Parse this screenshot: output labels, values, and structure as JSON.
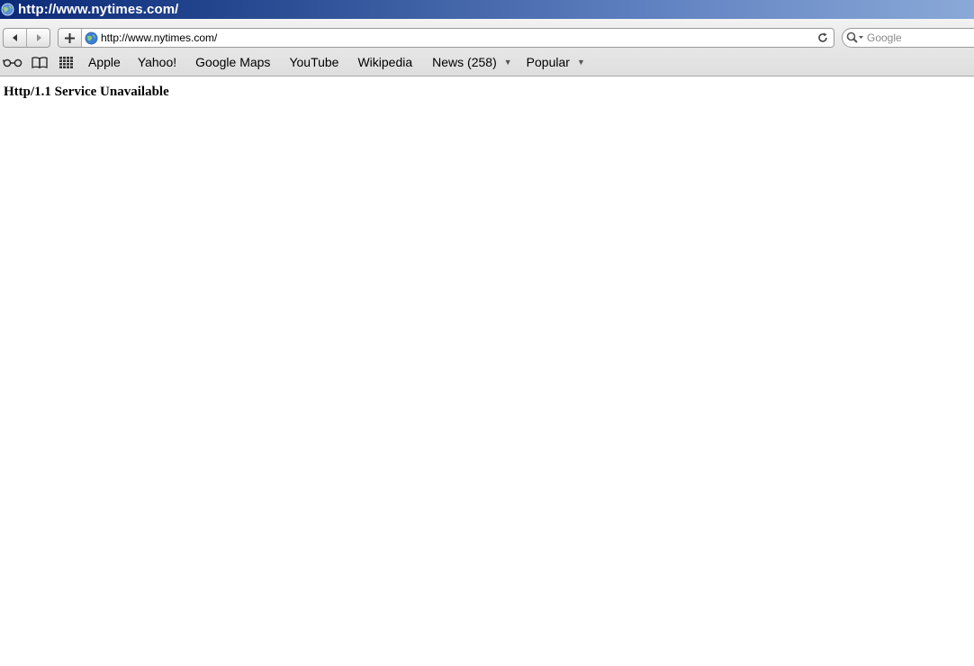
{
  "window": {
    "title": "http://www.nytimes.com/"
  },
  "toolbar": {
    "back_icon": "back-arrow-icon",
    "forward_icon": "forward-arrow-icon",
    "add_icon": "plus-icon",
    "address": {
      "value": "http://www.nytimes.com/"
    },
    "reload_icon": "reload-icon",
    "search": {
      "placeholder": "Google"
    }
  },
  "bookmarks": {
    "items": [
      {
        "label": "Apple",
        "has_menu": false
      },
      {
        "label": "Yahoo!",
        "has_menu": false
      },
      {
        "label": "Google Maps",
        "has_menu": false
      },
      {
        "label": "YouTube",
        "has_menu": false
      },
      {
        "label": "Wikipedia",
        "has_menu": false
      },
      {
        "label": "News (258)",
        "has_menu": true
      },
      {
        "label": "Popular",
        "has_menu": true
      }
    ],
    "menu_caret": "▼"
  },
  "page": {
    "heading": "Http/1.1 Service Unavailable"
  },
  "colors": {
    "titlebar_start": "#0b2a78",
    "titlebar_end": "#8aa9d8",
    "chrome_bg": "#e6e6e6"
  }
}
